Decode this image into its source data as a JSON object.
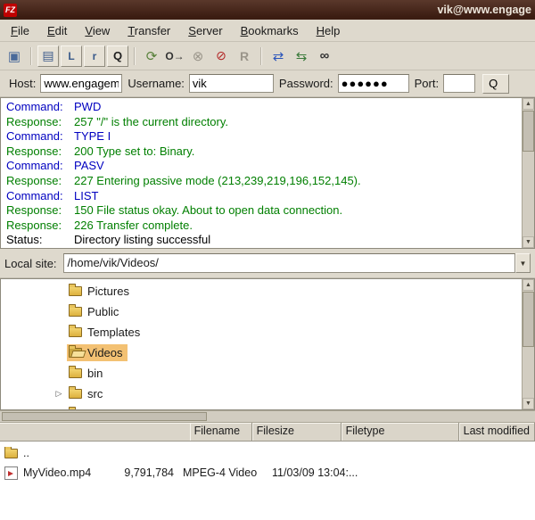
{
  "window": {
    "title": "vik@www.engage"
  },
  "menu": {
    "items": [
      {
        "label": "File"
      },
      {
        "label": "Edit"
      },
      {
        "label": "View"
      },
      {
        "label": "Transfer"
      },
      {
        "label": "Server"
      },
      {
        "label": "Bookmarks"
      },
      {
        "label": "Help"
      }
    ]
  },
  "toolbar": {
    "site_manager": "▣",
    "toggle_log": "▤",
    "toggle_local_tree": "L",
    "toggle_remote_tree": "r",
    "toggle_queue": "Q",
    "refresh": "⟳",
    "process_queue": "O→",
    "cancel": "⊗",
    "disconnect": "⊘",
    "reconnect": "R",
    "compare": "⇄",
    "sync_browse": "⇆",
    "find": "∞"
  },
  "quickconnect": {
    "host_label": "Host:",
    "host_value": "www.engageme",
    "username_label": "Username:",
    "username_value": "vik",
    "password_label": "Password:",
    "password_value": "●●●●●●",
    "port_label": "Port:",
    "port_value": "",
    "button_label": "Q"
  },
  "log": {
    "lines": [
      {
        "type": "command",
        "prefix": "Command:",
        "text": "PWD"
      },
      {
        "type": "response",
        "prefix": "Response:",
        "text": "257 \"/\" is the current directory."
      },
      {
        "type": "command",
        "prefix": "Command:",
        "text": "TYPE I"
      },
      {
        "type": "response",
        "prefix": "Response:",
        "text": "200 Type set to: Binary."
      },
      {
        "type": "command",
        "prefix": "Command:",
        "text": "PASV"
      },
      {
        "type": "response",
        "prefix": "Response:",
        "text": "227 Entering passive mode (213,239,219,196,152,145)."
      },
      {
        "type": "command",
        "prefix": "Command:",
        "text": "LIST"
      },
      {
        "type": "response",
        "prefix": "Response:",
        "text": "150 File status okay. About to open data connection."
      },
      {
        "type": "response",
        "prefix": "Response:",
        "text": "226 Transfer complete."
      },
      {
        "type": "status",
        "prefix": "Status:",
        "text": "Directory listing successful"
      }
    ]
  },
  "local_site": {
    "label": "Local site:",
    "value": "/home/vik/Videos/",
    "dropdown_glyph": "▼"
  },
  "tree": {
    "items": [
      {
        "label": "Pictures",
        "icon": "folder",
        "expander": ""
      },
      {
        "label": "Public",
        "icon": "folder",
        "expander": ""
      },
      {
        "label": "Templates",
        "icon": "folder",
        "expander": ""
      },
      {
        "label": "Videos",
        "icon": "folder-open",
        "expander": "",
        "state": "selected"
      },
      {
        "label": "bin",
        "icon": "folder",
        "expander": ""
      },
      {
        "label": "src",
        "icon": "folder",
        "expander": "▷"
      },
      {
        "label": "",
        "icon": "folder",
        "expander": ""
      }
    ]
  },
  "file_list": {
    "headers": [
      {
        "label": "Filename"
      },
      {
        "label": "Filesize"
      },
      {
        "label": "Filetype"
      },
      {
        "label": "Last modified"
      }
    ],
    "rows": [
      {
        "name": "..",
        "size": "",
        "type": "",
        "modified": "",
        "icon": "folder"
      },
      {
        "name": "MyVideo.mp4",
        "size": "9,791,784",
        "type": "MPEG-4 Video",
        "modified": "11/03/09 13:04:...",
        "icon": "video"
      }
    ]
  },
  "colors": {
    "titlebar": "#3c1d12",
    "selection": "#f3c173",
    "command_text": "#0000c0",
    "response_text": "#007f00"
  }
}
